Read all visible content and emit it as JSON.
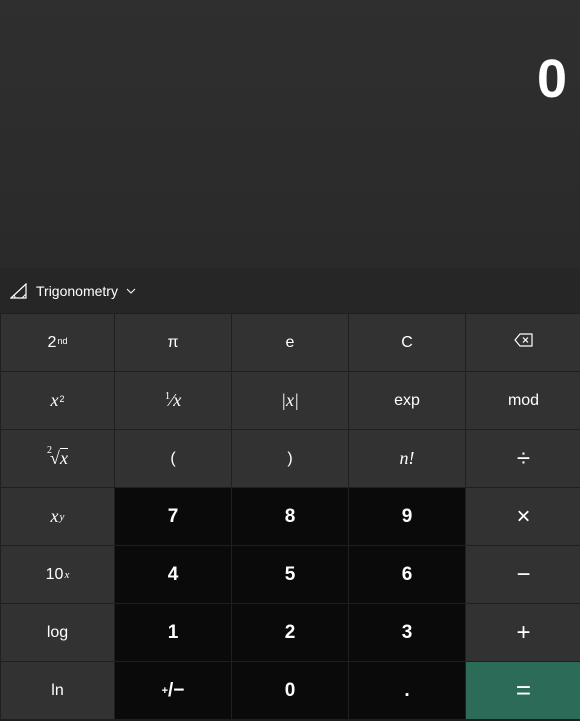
{
  "display": {
    "value": "0"
  },
  "function_bar": {
    "trigonometry_label": "Trigonometry",
    "trig_icon": "triangle-angle-icon",
    "chevron_icon": "chevron-down-icon"
  },
  "keys": {
    "second": {
      "base": "2",
      "sup": "nd"
    },
    "pi": "π",
    "e": "e",
    "clear": "C",
    "backspace_icon": "backspace-icon",
    "x_squared": {
      "base": "x",
      "sup": "2"
    },
    "reciprocal": {
      "num": "1",
      "slash": "⁄",
      "den": "x"
    },
    "abs": "|x|",
    "exp": "exp",
    "mod": "mod",
    "sqrt": {
      "index": "2",
      "radical": "√",
      "var": "x"
    },
    "open_paren": "(",
    "close_paren": ")",
    "factorial": "n!",
    "divide": "÷",
    "x_pow_y": {
      "base": "x",
      "sup": "y"
    },
    "seven": "7",
    "eight": "8",
    "nine": "9",
    "multiply": "×",
    "ten_pow_x": {
      "base": "10",
      "sup": "x"
    },
    "four": "4",
    "five": "5",
    "six": "6",
    "minus": "−",
    "log": "log",
    "one": "1",
    "two": "2",
    "three": "3",
    "plus": "+",
    "ln": "ln",
    "negate": {
      "sup": "+",
      "rest": "/−"
    },
    "zero": "0",
    "decimal": ".",
    "equals": "="
  },
  "colors": {
    "background": "#2b2b2b",
    "function_key": "#323232",
    "number_key": "#0a0a0a",
    "equals_key": "#2d6b59",
    "text": "#ffffff"
  }
}
